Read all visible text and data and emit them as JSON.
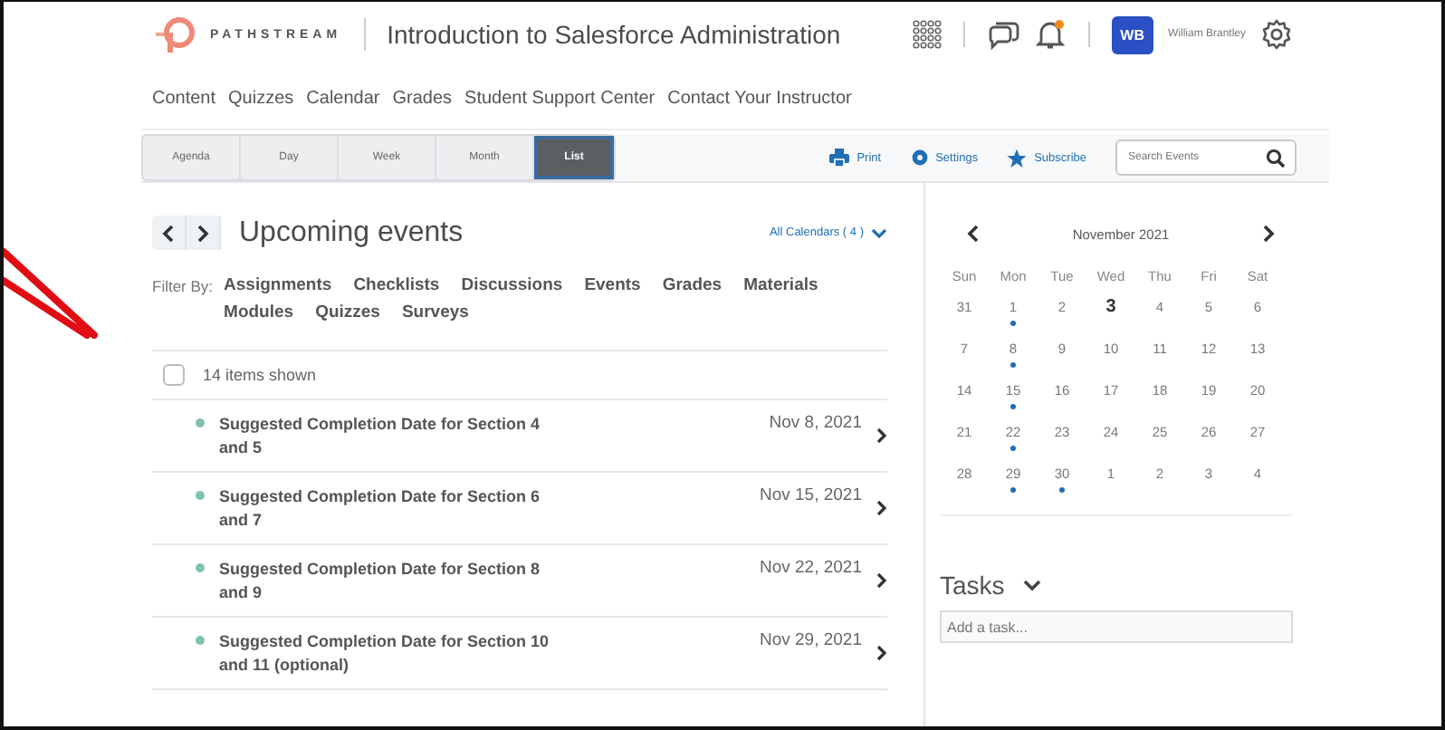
{
  "header": {
    "brand": "PATHSTREAM",
    "course_title": "Introduction to Salesforce Administration",
    "notifications_unread": true,
    "user": {
      "initials": "WB",
      "name": "William Brantley"
    }
  },
  "nav": [
    "Content",
    "Quizzes",
    "Calendar",
    "Grades",
    "Student Support Center",
    "Contact Your Instructor"
  ],
  "view_tabs": [
    {
      "label": "Agenda",
      "selected": false
    },
    {
      "label": "Day",
      "selected": false
    },
    {
      "label": "Week",
      "selected": false
    },
    {
      "label": "Month",
      "selected": false
    },
    {
      "label": "List",
      "selected": true
    }
  ],
  "actions": [
    {
      "label": "Print",
      "kind": "print"
    },
    {
      "label": "Settings",
      "kind": "settings"
    },
    {
      "label": "Subscribe",
      "kind": "subscribe"
    }
  ],
  "search": {
    "placeholder": "Search Events"
  },
  "events_panel": {
    "title": "Upcoming events",
    "calendars_link": "All Calendars ( 4 )",
    "filter_label": "Filter By:",
    "filters": [
      "Assignments",
      "Checklists",
      "Discussions",
      "Events",
      "Grades",
      "Materials",
      "Modules",
      "Quizzes",
      "Surveys"
    ],
    "select_all": {
      "label": "14 items shown",
      "checked": false
    },
    "events": [
      {
        "title": "Suggested Completion Date for Section 4 and 5",
        "date": "Nov 8, 2021"
      },
      {
        "title": "Suggested Completion Date for Section 6 and 7",
        "date": "Nov 15, 2021"
      },
      {
        "title": "Suggested Completion Date for Section 8 and 9",
        "date": "Nov 22, 2021"
      },
      {
        "title": "Suggested Completion Date for Section 10 and 11 (optional)",
        "date": "Nov 29, 2021"
      }
    ]
  },
  "mini_calendar": {
    "month": "November 2021",
    "weekdays": [
      "Sun",
      "Mon",
      "Tue",
      "Wed",
      "Thu",
      "Fri",
      "Sat"
    ],
    "weeks": [
      [
        {
          "day": "31",
          "today": false,
          "has_event": false
        },
        {
          "day": "1",
          "today": false,
          "has_event": true
        },
        {
          "day": "2",
          "today": false,
          "has_event": false
        },
        {
          "day": "3",
          "today": true,
          "has_event": false
        },
        {
          "day": "4",
          "today": false,
          "has_event": false
        },
        {
          "day": "5",
          "today": false,
          "has_event": false
        },
        {
          "day": "6",
          "today": false,
          "has_event": false
        }
      ],
      [
        {
          "day": "7",
          "today": false,
          "has_event": false
        },
        {
          "day": "8",
          "today": false,
          "has_event": true
        },
        {
          "day": "9",
          "today": false,
          "has_event": false
        },
        {
          "day": "10",
          "today": false,
          "has_event": false
        },
        {
          "day": "11",
          "today": false,
          "has_event": false
        },
        {
          "day": "12",
          "today": false,
          "has_event": false
        },
        {
          "day": "13",
          "today": false,
          "has_event": false
        }
      ],
      [
        {
          "day": "14",
          "today": false,
          "has_event": false
        },
        {
          "day": "15",
          "today": false,
          "has_event": true
        },
        {
          "day": "16",
          "today": false,
          "has_event": false
        },
        {
          "day": "17",
          "today": false,
          "has_event": false
        },
        {
          "day": "18",
          "today": false,
          "has_event": false
        },
        {
          "day": "19",
          "today": false,
          "has_event": false
        },
        {
          "day": "20",
          "today": false,
          "has_event": false
        }
      ],
      [
        {
          "day": "21",
          "today": false,
          "has_event": false
        },
        {
          "day": "22",
          "today": false,
          "has_event": true
        },
        {
          "day": "23",
          "today": false,
          "has_event": false
        },
        {
          "day": "24",
          "today": false,
          "has_event": false
        },
        {
          "day": "25",
          "today": false,
          "has_event": false
        },
        {
          "day": "26",
          "today": false,
          "has_event": false
        },
        {
          "day": "27",
          "today": false,
          "has_event": false
        }
      ],
      [
        {
          "day": "28",
          "today": false,
          "has_event": false
        },
        {
          "day": "29",
          "today": false,
          "has_event": true
        },
        {
          "day": "30",
          "today": false,
          "has_event": true
        },
        {
          "day": "1",
          "today": false,
          "has_event": false
        },
        {
          "day": "2",
          "today": false,
          "has_event": false
        },
        {
          "day": "3",
          "today": false,
          "has_event": false
        },
        {
          "day": "4",
          "today": false,
          "has_event": false
        }
      ]
    ]
  },
  "tasks": {
    "title": "Tasks",
    "placeholder": "Add a task..."
  }
}
